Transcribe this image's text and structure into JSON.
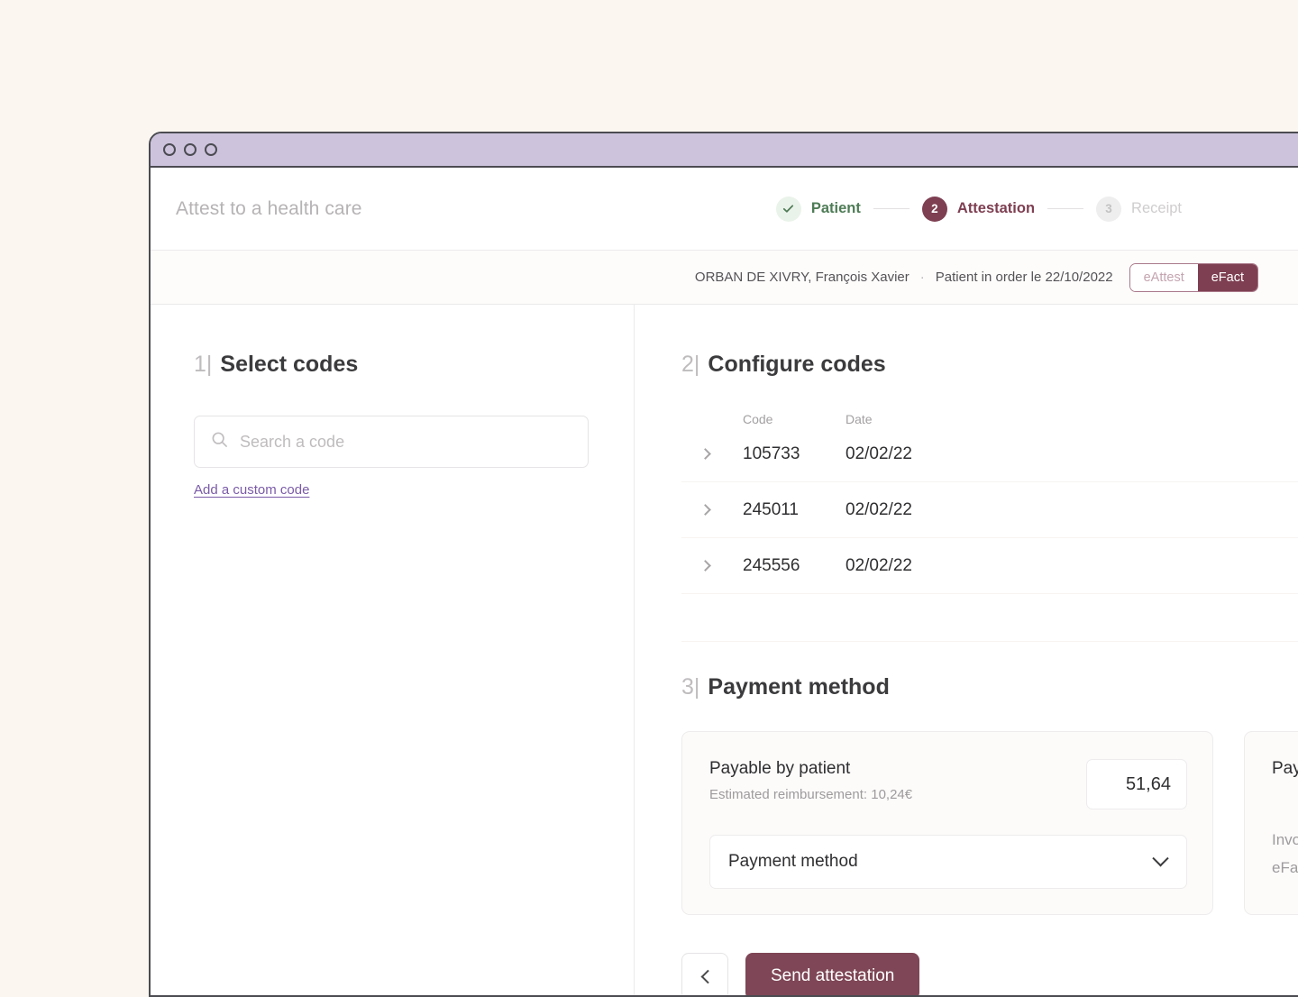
{
  "window": {
    "traffic_dots": [
      "dot-1",
      "dot-2",
      "dot-3"
    ]
  },
  "header": {
    "title": "Attest to a health care",
    "steps": [
      {
        "badge": "check-icon",
        "label": "Patient",
        "state": "done"
      },
      {
        "badge": "2",
        "label": "Attestation",
        "state": "current"
      },
      {
        "badge": "3",
        "label": "Receipt",
        "state": "todo"
      }
    ]
  },
  "patient_bar": {
    "name": "ORBAN DE XIVRY, François Xavier",
    "separator": "·",
    "order_status": "Patient in order le 22/10/2022",
    "toggle": {
      "options": [
        "eAttest",
        "eFact"
      ],
      "selected": "eFact"
    }
  },
  "left_panel": {
    "step_number": "1|",
    "title": "Select codes",
    "search": {
      "placeholder": "Search a code",
      "value": "",
      "icon": "search-icon"
    },
    "custom_code_link": "Add a custom code"
  },
  "configure_codes": {
    "step_number": "2|",
    "title": "Configure codes",
    "columns": [
      "Code",
      "Date"
    ],
    "rows": [
      {
        "code": "105733",
        "date": "02/02/22"
      },
      {
        "code": "245011",
        "date": "02/02/22"
      },
      {
        "code": "245556",
        "date": "02/02/22"
      }
    ]
  },
  "payment_method": {
    "step_number": "3|",
    "title": "Payment method",
    "primary_card": {
      "label": "Payable by patient",
      "sublabel": "Estimated reimbursement: 10,24€",
      "amount": "51,64",
      "select_value": "Payment method"
    },
    "secondary_card": {
      "label": "Pay",
      "line_1": "Invo",
      "line_2": "eFa"
    }
  },
  "actions": {
    "back_label": "chevron-left-icon",
    "send_label": "Send attestation"
  },
  "colors": {
    "background": "#fbf7f0",
    "titlebar": "#cdc3dd",
    "accent_maroon": "#7e3f52",
    "accent_green": "#4e7c56",
    "link_purple": "#7a5ba8",
    "frame_border": "#4b4b52"
  }
}
